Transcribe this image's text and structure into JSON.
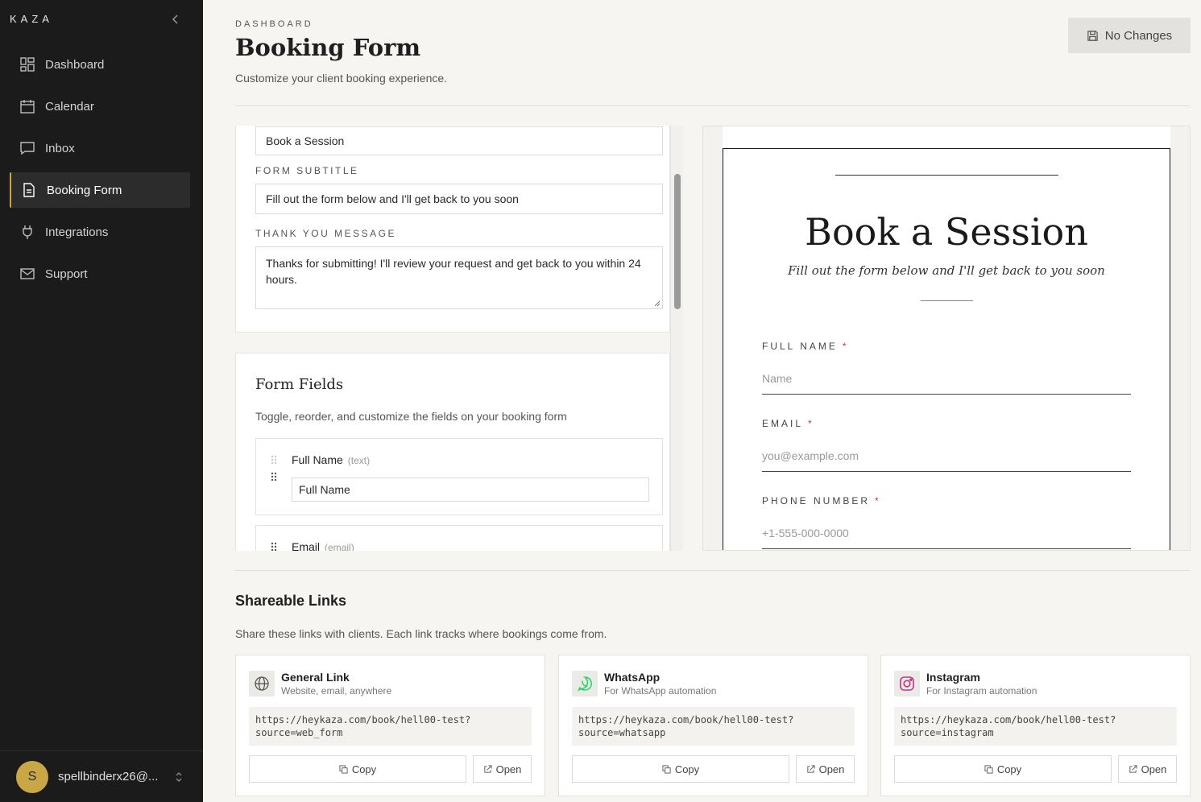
{
  "app": {
    "brand": "KAZA"
  },
  "sidebar": {
    "items": [
      {
        "label": "Dashboard",
        "icon": "dashboard-icon"
      },
      {
        "label": "Calendar",
        "icon": "calendar-icon"
      },
      {
        "label": "Inbox",
        "icon": "inbox-icon"
      },
      {
        "label": "Booking Form",
        "icon": "document-icon",
        "active": true
      },
      {
        "label": "Integrations",
        "icon": "plug-icon"
      },
      {
        "label": "Support",
        "icon": "mail-icon"
      }
    ],
    "user": {
      "initial": "S",
      "email": "spellbinderx26@..."
    }
  },
  "header": {
    "breadcrumb": "DASHBOARD",
    "title": "Booking Form",
    "subtitle": "Customize your client booking experience.",
    "save_label": "No Changes"
  },
  "settings": {
    "form_title_value": "Book a Session",
    "subtitle_label": "FORM SUBTITLE",
    "subtitle_value": "Fill out the form below and I'll get back to you soon",
    "thankyou_label": "THANK YOU MESSAGE",
    "thankyou_value": "Thanks for submitting! I'll review your request and get back to you within 24 hours."
  },
  "form_fields": {
    "title": "Form Fields",
    "description": "Toggle, reorder, and customize the fields on your booking form",
    "fields": [
      {
        "name": "Full Name",
        "type": "(text)",
        "value": "Full Name"
      },
      {
        "name": "Email",
        "type": "(email)"
      }
    ]
  },
  "preview": {
    "title": "Book a Session",
    "subtitle": "Fill out the form below and I'll get back to you soon",
    "fields": [
      {
        "label": "FULL NAME",
        "required": "*",
        "placeholder": "Name"
      },
      {
        "label": "EMAIL",
        "required": "*",
        "placeholder": "you@example.com"
      },
      {
        "label": "PHONE NUMBER",
        "required": "*",
        "placeholder": "+1-555-000-0000"
      }
    ]
  },
  "shareable": {
    "title": "Shareable Links",
    "description": "Share these links with clients. Each link tracks where bookings come from.",
    "links": [
      {
        "name": "General Link",
        "sub": "Website, email, anywhere",
        "url": "https://heykaza.com/book/hell00-test?\nsource=web_form",
        "copy": "Copy",
        "open": "Open",
        "icon": "globe-icon"
      },
      {
        "name": "WhatsApp",
        "sub": "For WhatsApp automation",
        "url": "https://heykaza.com/book/hell00-test?\nsource=whatsapp",
        "copy": "Copy",
        "open": "Open",
        "icon": "whatsapp-icon"
      },
      {
        "name": "Instagram",
        "sub": "For Instagram automation",
        "url": "https://heykaza.com/book/hell00-test?\nsource=instagram",
        "copy": "Copy",
        "open": "Open",
        "icon": "instagram-icon"
      }
    ]
  },
  "colors": {
    "accent": "#c9a646",
    "sidebar_bg": "#1b1b1b",
    "required": "#c0392b",
    "whatsapp": "#25d366",
    "instagram": "#c13584"
  }
}
